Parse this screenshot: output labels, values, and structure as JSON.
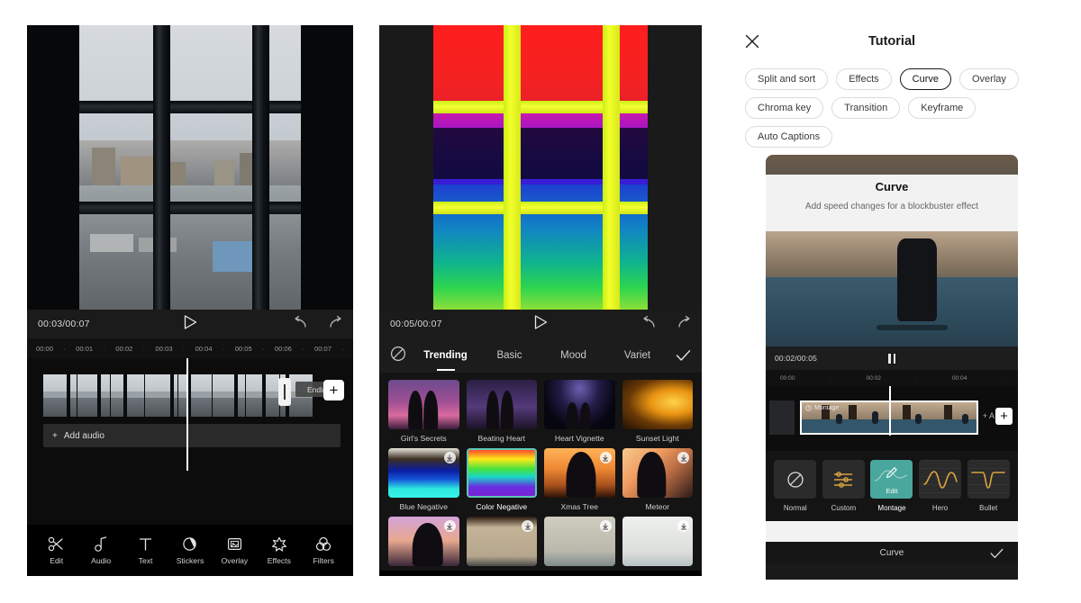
{
  "panel1": {
    "name": "video-editor",
    "transport": {
      "time": "00:03/00:07",
      "play_icon": "play-icon",
      "undo_icon": "undo-icon",
      "redo_icon": "redo-icon"
    },
    "ruler": {
      "ticks": [
        "00:00",
        "00:01",
        "00:02",
        "00:03",
        "00:04",
        "00:05",
        "00:06",
        "00:07"
      ],
      "dot": "·"
    },
    "timeline": {
      "ending_badge": "Ending",
      "add_audio": "Add audio",
      "add_plus": "+",
      "plus_clip": "+"
    },
    "toolbar": [
      {
        "label": "Edit",
        "icon": "scissors-icon"
      },
      {
        "label": "Audio",
        "icon": "music-note-icon"
      },
      {
        "label": "Text",
        "icon": "text-t-icon"
      },
      {
        "label": "Stickers",
        "icon": "sticker-icon"
      },
      {
        "label": "Overlay",
        "icon": "overlay-icon"
      },
      {
        "label": "Effects",
        "icon": "sparkle-icon"
      },
      {
        "label": "Filters",
        "icon": "filters-icon"
      }
    ]
  },
  "panel2": {
    "name": "effects-picker",
    "transport": {
      "time": "00:05/00:07",
      "play_icon": "play-icon",
      "undo_icon": "undo-icon",
      "redo_icon": "redo-icon"
    },
    "tabs": {
      "none_icon": "no-effect-icon",
      "items": [
        "Trending",
        "Basic",
        "Mood",
        "Variet"
      ],
      "active": "Trending",
      "confirm_icon": "check-icon"
    },
    "effects": [
      {
        "label": "Girl's Secrets",
        "art": "t-girls",
        "download": false,
        "selected": false
      },
      {
        "label": "Beating Heart",
        "art": "t-beat",
        "download": false,
        "selected": false
      },
      {
        "label": "Heart Vignette",
        "art": "t-hv",
        "download": false,
        "selected": false
      },
      {
        "label": "Sunset Light",
        "art": "t-sun",
        "download": false,
        "selected": false
      },
      {
        "label": "Blue Negative",
        "art": "t-blueneg",
        "download": true,
        "selected": false
      },
      {
        "label": "Color Negative",
        "art": "t-colneg",
        "download": false,
        "selected": true
      },
      {
        "label": "Xmas Tree",
        "art": "t-xmas",
        "download": true,
        "selected": false
      },
      {
        "label": "Meteor",
        "art": "t-met",
        "download": true,
        "selected": false
      },
      {
        "label": "",
        "art": "t-r3a",
        "download": true,
        "selected": false
      },
      {
        "label": "",
        "art": "t-r3b",
        "download": true,
        "selected": false
      },
      {
        "label": "",
        "art": "t-r3c",
        "download": true,
        "selected": false
      },
      {
        "label": "",
        "art": "t-r3d",
        "download": true,
        "selected": false
      }
    ]
  },
  "panel3": {
    "name": "tutorial-sheet",
    "header": {
      "title": "Tutorial",
      "close_icon": "close-icon"
    },
    "chips": [
      {
        "label": "Split and sort",
        "active": false
      },
      {
        "label": "Effects",
        "active": false
      },
      {
        "label": "Curve",
        "active": true
      },
      {
        "label": "Overlay",
        "active": false
      },
      {
        "label": "Chroma key",
        "active": false
      },
      {
        "label": "Transition",
        "active": false
      },
      {
        "label": "Keyframe",
        "active": false
      },
      {
        "label": "Auto Captions",
        "active": false
      }
    ],
    "card": {
      "title": "Curve",
      "subtitle": "Add speed changes for a blockbuster effect"
    },
    "inner_editor": {
      "transport": {
        "time": "00:02/00:05",
        "pause_icon": "pause-icon"
      },
      "ruler": {
        "ticks": [
          "00:00",
          "00:02",
          "00:04"
        ],
        "dot": "·"
      },
      "clip_label": "Montage",
      "clip_icon": "speed-icon",
      "add_text": "+ A",
      "add_plus": "+"
    },
    "curve_presets": [
      {
        "label": "Normal",
        "icon": "no-curve-icon",
        "active": false
      },
      {
        "label": "Custom",
        "icon": "sliders-icon",
        "active": false
      },
      {
        "label": "Montage",
        "icon": "pencil-icon",
        "active": true,
        "overlay": "Edit"
      },
      {
        "label": "Hero",
        "icon": "hero-curve-icon",
        "active": false
      },
      {
        "label": "Bullet",
        "icon": "bullet-curve-icon",
        "active": false
      }
    ],
    "bottom": {
      "label": "Curve",
      "confirm_icon": "check-icon"
    }
  },
  "colors": {
    "accent_teal": "#49a79e",
    "curve_gold": "#d9a441",
    "panel_dark": "#0c0c0c",
    "sheet_white": "#ffffff"
  }
}
